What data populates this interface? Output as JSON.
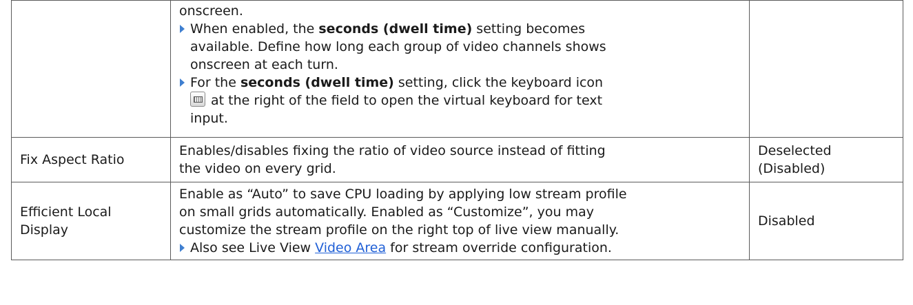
{
  "rows": [
    {
      "name": "",
      "description": {
        "intro": "onscreen.",
        "bullet1": {
          "before": "When enabled, the ",
          "bold": "seconds (dwell time)",
          "after_line1": " setting becomes",
          "line2": "available. Define how long each group of video channels shows",
          "line3": "onscreen at each turn."
        },
        "bullet2": {
          "before": "For the ",
          "bold": "seconds (dwell time)",
          "after_line1": " setting, click the keyboard icon",
          "icon": "keyboard-icon",
          "line2_after_icon": "at the right of the field to open the virtual keyboard for text",
          "line3": "input."
        }
      },
      "default": ""
    },
    {
      "name": "Fix Aspect Ratio",
      "description": {
        "line1": "Enables/disables fixing the ratio of video source instead of fitting",
        "line2": "the video on every grid."
      },
      "default_line1": "Deselected",
      "default_line2": "(Disabled)"
    },
    {
      "name_line1": "Efficient Local",
      "name_line2": "Display",
      "description": {
        "line1": "Enable as “Auto” to save CPU loading by applying low stream profile",
        "line2": "on small grids automatically. Enabled as “Customize”, you may",
        "line3": "customize the stream profile on the right top of live view manually.",
        "bullet": {
          "before": "Also see Live View ",
          "link": "Video Area",
          "after": " for stream override configuration."
        }
      },
      "default": "Disabled"
    }
  ]
}
